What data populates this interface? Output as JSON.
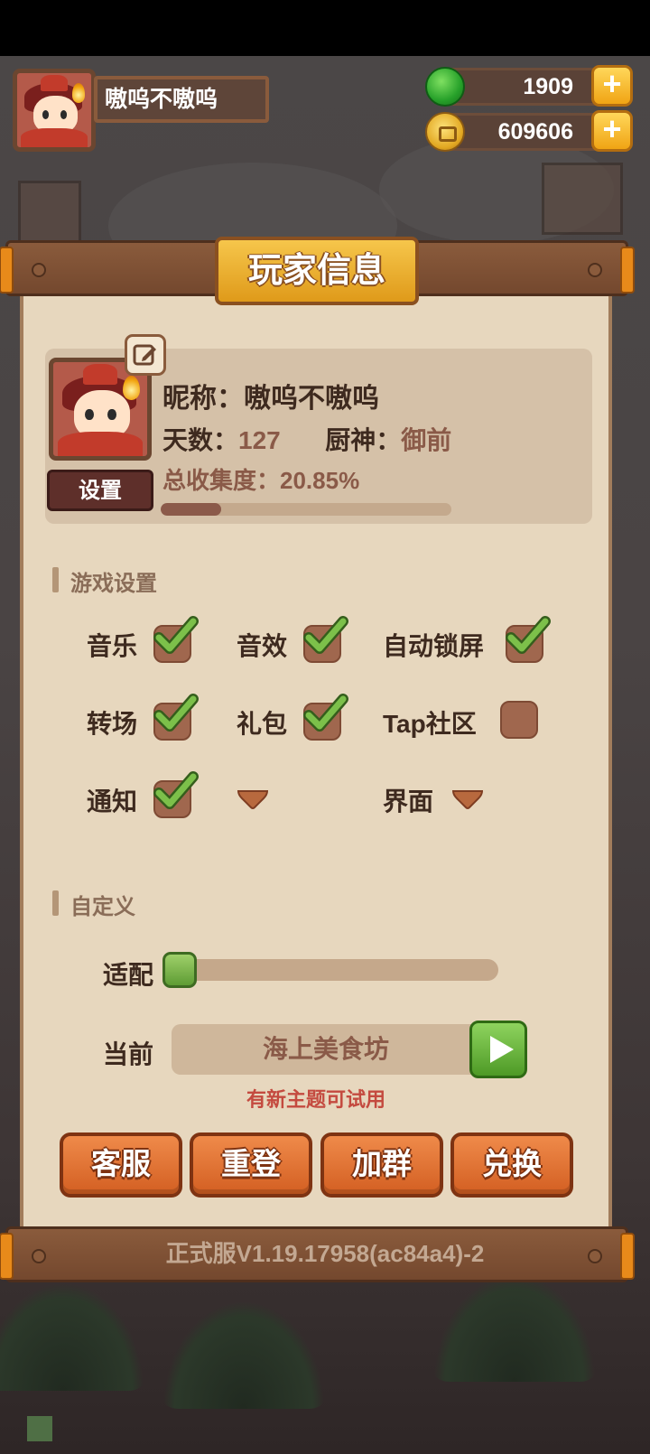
{
  "hud": {
    "player_name": "嗷呜不嗷呜",
    "jade": "1909",
    "coins": "609606"
  },
  "panel": {
    "title": "玩家信息",
    "version": "正式服V1.19.17958(ac84a4)-2"
  },
  "profile": {
    "nickname_label": "昵称：",
    "nickname": "嗷呜不嗷呜",
    "days_label": "天数：",
    "days": "127",
    "chef_label": "厨神：",
    "chef": "御前",
    "collection_label": "总收集度：",
    "collection": "20.85%",
    "collection_progress": 0.2085,
    "settings_button": "设置"
  },
  "game_settings": {
    "title": "游戏设置",
    "options": [
      {
        "label": "音乐",
        "checked": true
      },
      {
        "label": "音效",
        "checked": true
      },
      {
        "label": "自动锁屏",
        "checked": true
      },
      {
        "label": "转场",
        "checked": true
      },
      {
        "label": "礼包",
        "checked": true
      },
      {
        "label": "Tap社区",
        "checked": false
      },
      {
        "label": "通知",
        "checked": true
      }
    ],
    "interface_label": "界面"
  },
  "custom": {
    "title": "自定义",
    "adapt_label": "适配",
    "adapt_value": 0,
    "current_label": "当前",
    "current_theme": "海上美食坊",
    "hint": "有新主题可试用"
  },
  "actions": [
    "客服",
    "重登",
    "加群",
    "兑换"
  ],
  "colors": {
    "panel_bg": "#e7d7be",
    "accent_orange": "#d35f22",
    "check_green": "#6fb53f",
    "hint_red": "#c44a3f"
  }
}
